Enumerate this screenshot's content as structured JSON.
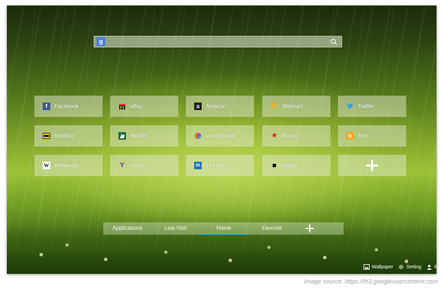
{
  "search": {
    "engine_letter": "g",
    "placeholder": ""
  },
  "tiles": [
    {
      "label": "Facebook",
      "icon": "facebook-icon",
      "glyph": "f",
      "color": "#3b5998"
    },
    {
      "label": "eBay",
      "icon": "ebay-icon",
      "glyph": "",
      "color": "#e53238"
    },
    {
      "label": "Amazon",
      "icon": "amazon-icon",
      "glyph": "a",
      "color": "#222222"
    },
    {
      "label": "Walmart",
      "icon": "walmart-icon",
      "glyph": "✱",
      "color": "#f6b31b"
    },
    {
      "label": "Twitter",
      "icon": "twitter-icon",
      "glyph": "",
      "color": "#1da1f2"
    },
    {
      "label": "BestBuy",
      "icon": "bestbuy-icon",
      "glyph": "",
      "color": "#f5d000"
    },
    {
      "label": "Bet365",
      "icon": "bet365-icon",
      "glyph": "",
      "color": "#1d6b3a"
    },
    {
      "label": "LivingSocial",
      "icon": "livingsocial-icon",
      "glyph": "",
      "color": "#e0662a"
    },
    {
      "label": "Macys",
      "icon": "macys-icon",
      "glyph": "★",
      "color": "#e21a2c"
    },
    {
      "label": "Msn",
      "icon": "msn-icon",
      "glyph": "b",
      "color": "#f5a623"
    },
    {
      "label": "Wikipedia",
      "icon": "wikipedia-icon",
      "glyph": "W",
      "color": "#ffffff"
    },
    {
      "label": "Yahoo",
      "icon": "yahoo-icon",
      "glyph": "Y",
      "color": "#6a2fb5"
    },
    {
      "label": "LinkedIn",
      "icon": "linkedin-icon",
      "glyph": "in",
      "color": "#1f74b5"
    },
    {
      "label": "eBags",
      "icon": "ebags-icon",
      "glyph": "",
      "color": "#111111"
    }
  ],
  "add_tile": {
    "icon": "plus-icon"
  },
  "nav": {
    "tabs": [
      "Applications",
      "Last Visit",
      "Home",
      "Favorite"
    ],
    "active": "Home",
    "active_color": "#2fb8d8"
  },
  "tools": {
    "wallpaper": "Wallpaper",
    "setting": "Setting",
    "third": "B"
  },
  "caption": "Image source: https://lh3.googleusercontent.com"
}
